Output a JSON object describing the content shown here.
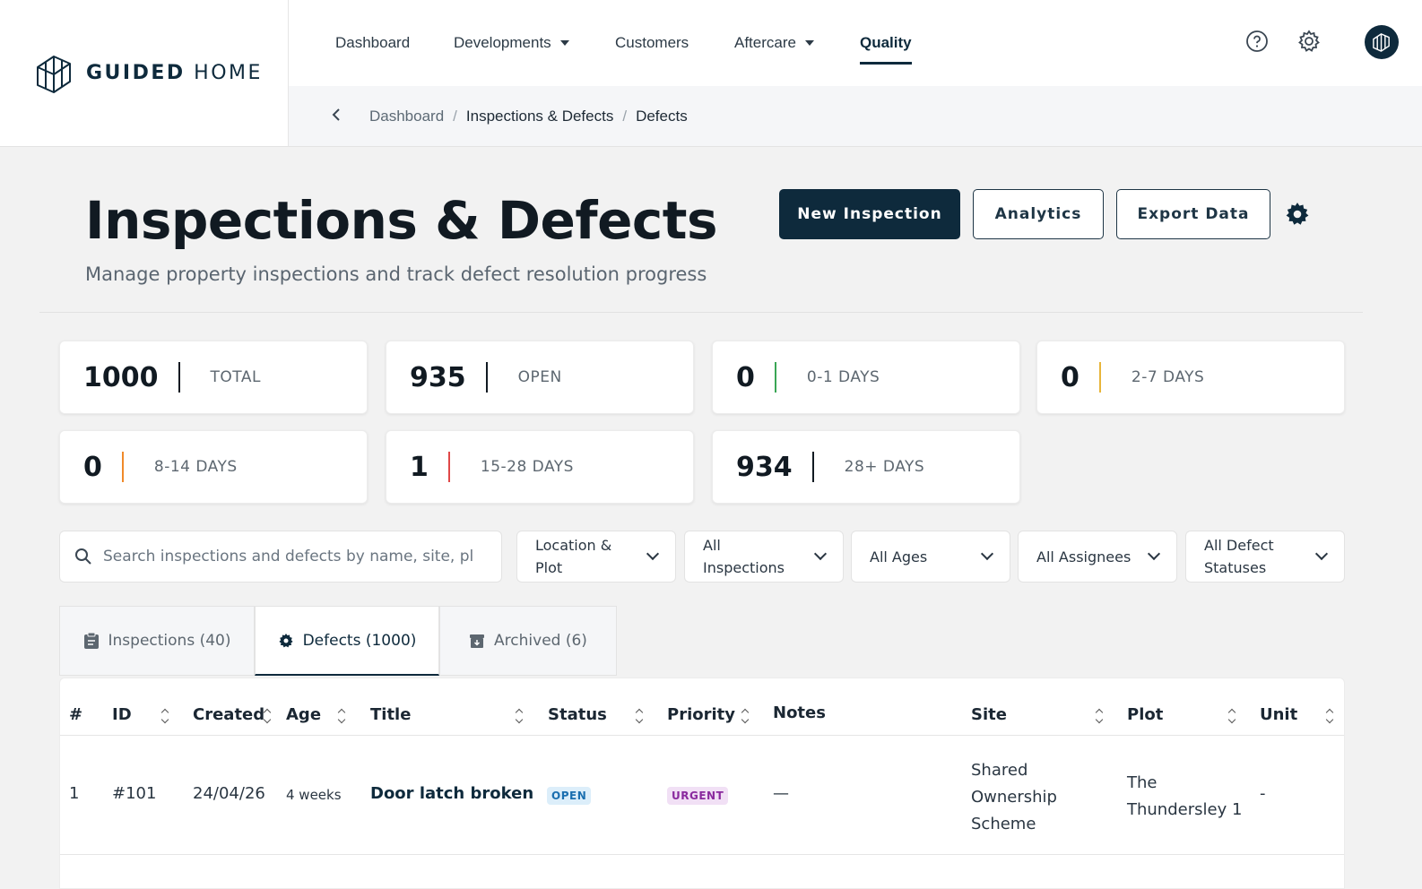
{
  "brand": {
    "name_bold": "GUIDED",
    "name_light": "HOME"
  },
  "nav": {
    "items": [
      {
        "label": "Dashboard",
        "dropdown": false,
        "active": false
      },
      {
        "label": "Developments",
        "dropdown": true,
        "active": false
      },
      {
        "label": "Customers",
        "dropdown": false,
        "active": false
      },
      {
        "label": "Aftercare",
        "dropdown": true,
        "active": false
      },
      {
        "label": "Quality",
        "dropdown": false,
        "active": true
      }
    ],
    "icons": [
      "help-icon",
      "settings-icon",
      "avatar"
    ]
  },
  "breadcrumb": {
    "items": [
      "Dashboard",
      "Inspections & Defects",
      "Defects"
    ]
  },
  "page": {
    "title": "Inspections & Defects",
    "subtitle": "Manage property inspections and track defect resolution progress",
    "buttons": {
      "new": "New Inspection",
      "analytics": "Analytics",
      "export": "Export Data"
    }
  },
  "stats": [
    {
      "value": "1000",
      "label": "TOTAL",
      "color": "#111a22"
    },
    {
      "value": "935",
      "label": "OPEN",
      "color": "#111a22"
    },
    {
      "value": "0",
      "label": "0-1 DAYS",
      "color": "#3aa655"
    },
    {
      "value": "0",
      "label": "2-7 DAYS",
      "color": "#e8b53a"
    },
    {
      "value": "0",
      "label": "8-14 DAYS",
      "color": "#f08a2a"
    },
    {
      "value": "1",
      "label": "15-28 DAYS",
      "color": "#e04848"
    },
    {
      "value": "934",
      "label": "28+ DAYS",
      "color": "#111a22"
    }
  ],
  "filters": {
    "search_placeholder": "Search inspections and defects by name, site, pl",
    "dropdowns": [
      {
        "line1": "Location &",
        "line2": "Plot"
      },
      {
        "line1": "All",
        "line2": "Inspections"
      },
      {
        "line1": "All Ages",
        "line2": ""
      },
      {
        "line1": "All Assignees",
        "line2": ""
      },
      {
        "line1": "All Defect",
        "line2": "Statuses"
      }
    ]
  },
  "tabs": [
    {
      "label": "Inspections (40)",
      "icon": "clipboard-icon",
      "active": false
    },
    {
      "label": "Defects (1000)",
      "icon": "bug-icon",
      "active": true
    },
    {
      "label": "Archived (6)",
      "icon": "archive-icon",
      "active": false
    }
  ],
  "table": {
    "columns": [
      "#",
      "ID",
      "Created",
      "Age",
      "Title",
      "Status",
      "Priority",
      "Notes",
      "Site",
      "Plot",
      "Unit"
    ],
    "rows": [
      {
        "num": "1",
        "id": "#101",
        "created": "24/04/26",
        "age": "4 weeks",
        "title": "Door latch broken",
        "status": "OPEN",
        "priority": "URGENT",
        "notes": "—",
        "site_lines": [
          "Shared",
          "Ownership",
          "Scheme"
        ],
        "plot_lines": [
          "The",
          "Thundersley 1"
        ],
        "unit": "-"
      }
    ]
  },
  "colors": {
    "brand": "#0e2a3c",
    "status_open_bg": "#dceefa",
    "status_open_fg": "#1a6fb0",
    "priority_urgent_bg": "#f1e0f5",
    "priority_urgent_fg": "#8a2a9e"
  }
}
